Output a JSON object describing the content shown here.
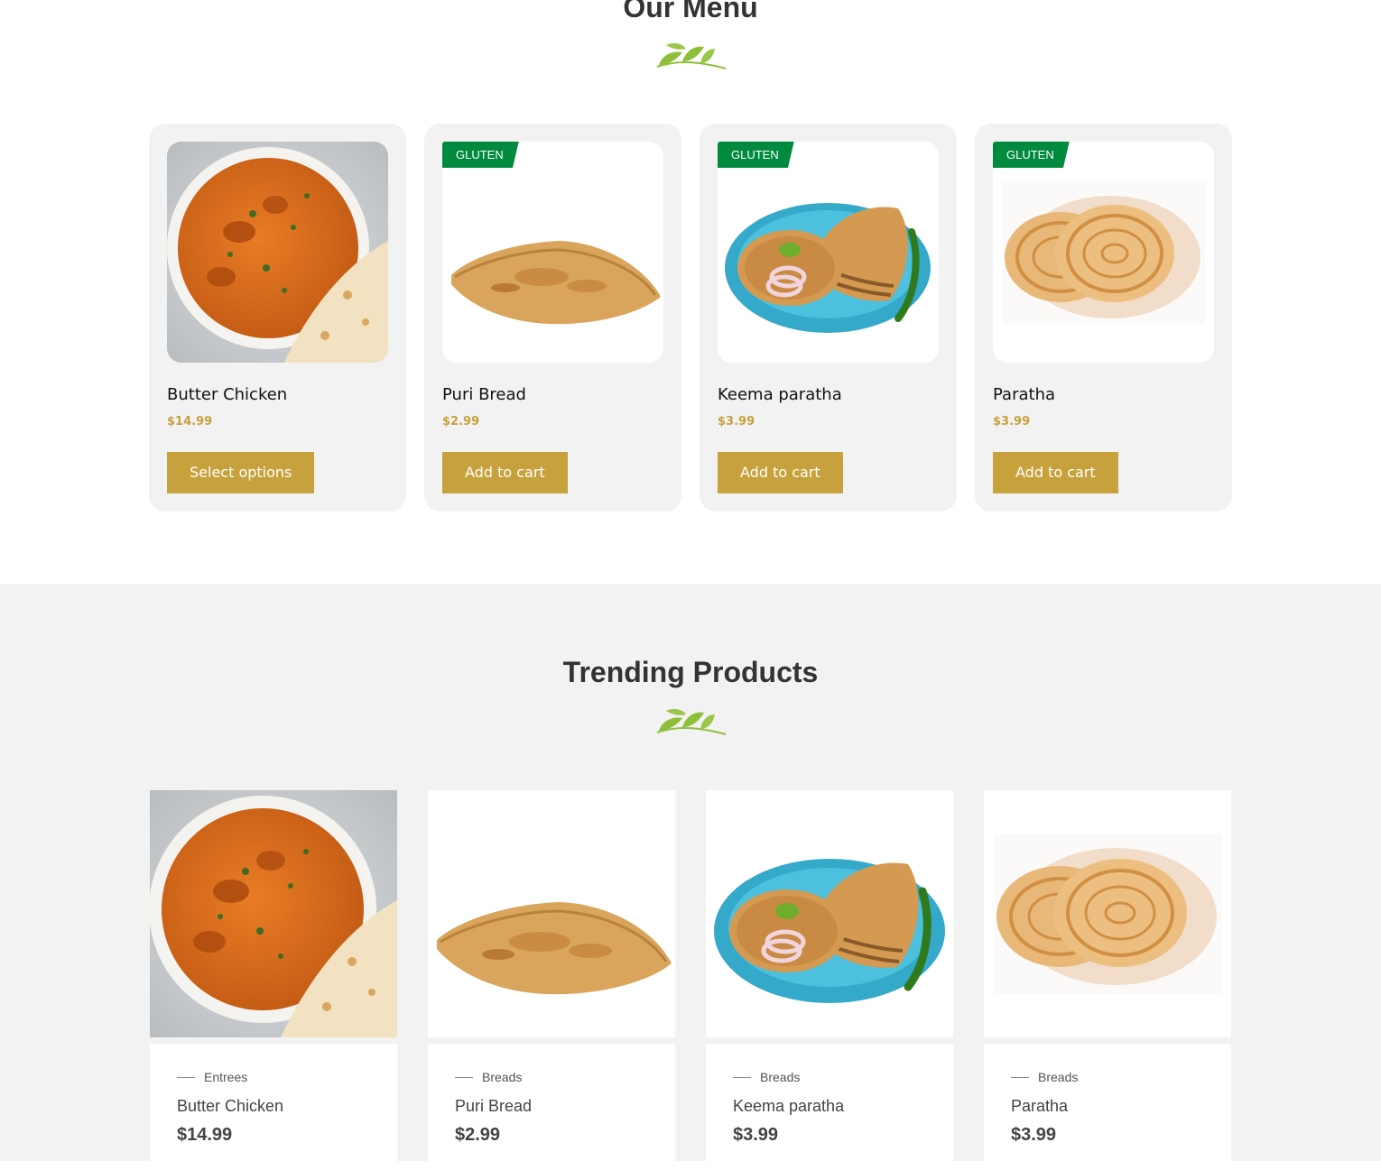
{
  "menu": {
    "title": "Our Menu",
    "items": [
      {
        "name": "Butter Chicken",
        "price": "$14.99",
        "button": "Select options",
        "badge": "",
        "image": "butter-chicken-bowl"
      },
      {
        "name": "Puri Bread",
        "price": "$2.99",
        "button": "Add to cart",
        "badge": "GLUTEN",
        "image": "puri-bread"
      },
      {
        "name": "Keema paratha",
        "price": "$3.99",
        "button": "Add to cart",
        "badge": "GLUTEN",
        "image": "keema-paratha-plate"
      },
      {
        "name": "Paratha",
        "price": "$3.99",
        "button": "Add to cart",
        "badge": "GLUTEN",
        "image": "paratha-stack"
      }
    ]
  },
  "trending": {
    "title": "Trending Products",
    "items": [
      {
        "category": "Entrees",
        "name": "Butter Chicken",
        "price": "$14.99"
      },
      {
        "category": "Breads",
        "name": "Puri Bread",
        "price": "$2.99"
      },
      {
        "category": "Breads",
        "name": "Keema paratha",
        "price": "$3.99"
      },
      {
        "category": "Breads",
        "name": "Paratha",
        "price": "$3.99"
      }
    ]
  },
  "colors": {
    "accent": "#c6a13c",
    "badge": "#008a3e",
    "leaf": "#8fbf3a",
    "section_bg": "#f2f2f2"
  }
}
